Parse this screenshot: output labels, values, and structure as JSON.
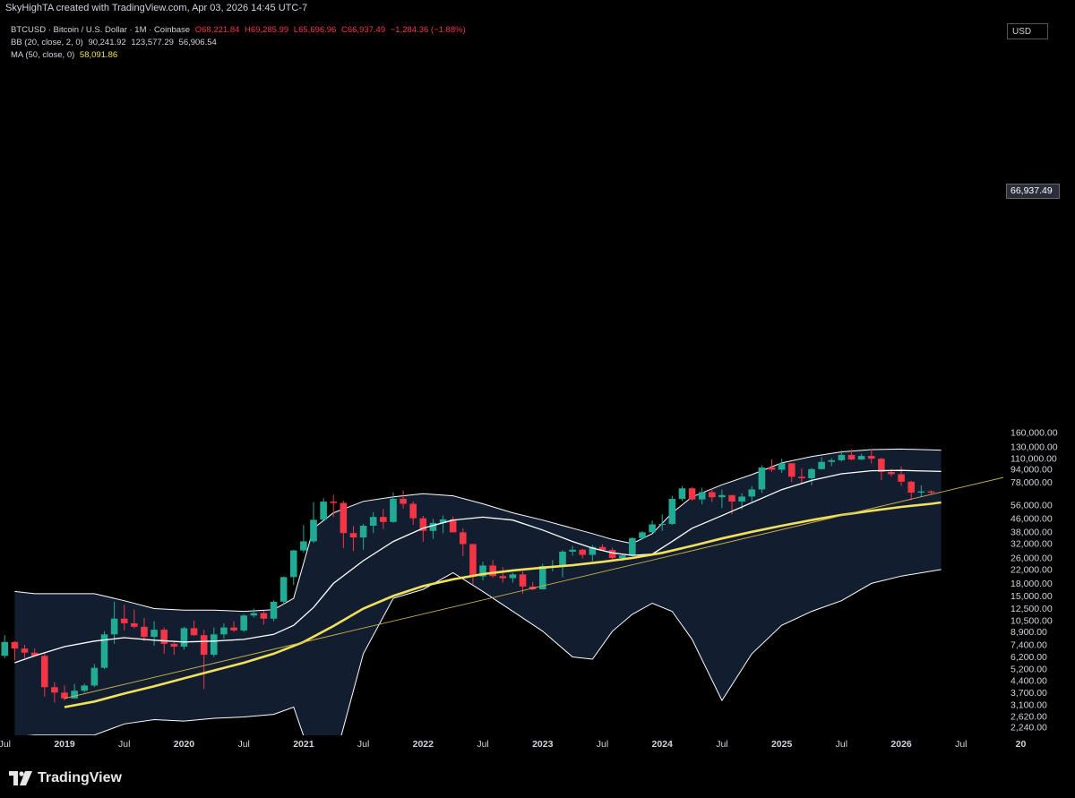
{
  "header": {
    "title": "SkyHighTA created with TradingView.com, Apr 03, 2026 14:45 UTC-7"
  },
  "legend": {
    "symbol": "BTCUSD · Bitcoin / U.S. Dollar · 1M · Coinbase",
    "open": "O68,221.84",
    "high": "H69,285.99",
    "low": "L65,696.96",
    "close": "C66,937.49",
    "change": "−1,284.36 (−1.88%)",
    "bb_label": "BB (20, close, 2, 0)",
    "bb_basis": "90,241.92",
    "bb_upper": "123,577.29",
    "bb_lower": "56,906.54",
    "ma_label": "MA (50, close, 0)",
    "ma_value": "58,091.86"
  },
  "price_axis": {
    "currency": "USD",
    "last_price": "66,937.49"
  },
  "footer": {
    "brand": "TradingView"
  },
  "colors": {
    "up": "#22ab94",
    "down": "#f23645",
    "bb_fill": "#131d30",
    "bb_line": "#ffffff",
    "ma": "#f0e05a",
    "trendline": "#c9b34a"
  },
  "chart_data": {
    "type": "candlestick",
    "scale": "log",
    "ylim": [
      2100,
      200000
    ],
    "y_ticks": [
      "2,240.00",
      "2,620.00",
      "3,100.00",
      "3,700.00",
      "4,400.00",
      "5,200.00",
      "6,200.00",
      "7,400.00",
      "8,900.00",
      "10,500.00",
      "12,500.00",
      "15,000.00",
      "18,000.00",
      "22,000.00",
      "26,000.00",
      "32,000.00",
      "38,000.00",
      "46,000.00",
      "56,000.00",
      "78,000.00",
      "94,000.00",
      "110,000.00",
      "130,000.00",
      "160,000.00"
    ],
    "y_tick_values": [
      2240,
      2620,
      3100,
      3700,
      4400,
      5200,
      6200,
      7400,
      8900,
      10500,
      12500,
      15000,
      18000,
      22000,
      26000,
      32000,
      38000,
      46000,
      56000,
      78000,
      94000,
      110000,
      130000,
      160000
    ],
    "x_ticks": [
      {
        "label": "Jul",
        "t": -6,
        "bold": false
      },
      {
        "label": "2019",
        "t": 0,
        "bold": true
      },
      {
        "label": "Jul",
        "t": 6,
        "bold": false
      },
      {
        "label": "2020",
        "t": 12,
        "bold": true
      },
      {
        "label": "Jul",
        "t": 18,
        "bold": false
      },
      {
        "label": "2021",
        "t": 24,
        "bold": true
      },
      {
        "label": "Jul",
        "t": 30,
        "bold": false
      },
      {
        "label": "2022",
        "t": 36,
        "bold": true
      },
      {
        "label": "Jul",
        "t": 42,
        "bold": false
      },
      {
        "label": "2023",
        "t": 48,
        "bold": true
      },
      {
        "label": "Jul",
        "t": 54,
        "bold": false
      },
      {
        "label": "2024",
        "t": 60,
        "bold": true
      },
      {
        "label": "Jul",
        "t": 66,
        "bold": false
      },
      {
        "label": "2025",
        "t": 72,
        "bold": true
      },
      {
        "label": "Jul",
        "t": 78,
        "bold": false
      },
      {
        "label": "2026",
        "t": 84,
        "bold": true
      },
      {
        "label": "Jul",
        "t": 90,
        "bold": false
      },
      {
        "label": "20",
        "t": 96,
        "bold": true
      }
    ],
    "time_reference": "Monthly candles; first candle = Jun 2018, last candle = Apr 2026",
    "candles": [
      {
        "date": "2018-06",
        "o": 7500,
        "h": 7800,
        "l": 5800,
        "c": 6300
      },
      {
        "date": "2018-07",
        "o": 6300,
        "h": 8500,
        "l": 6100,
        "c": 7700
      },
      {
        "date": "2018-08",
        "o": 7700,
        "h": 7800,
        "l": 5900,
        "c": 7000
      },
      {
        "date": "2018-09",
        "o": 7000,
        "h": 7400,
        "l": 6100,
        "c": 6600
      },
      {
        "date": "2018-10",
        "o": 6600,
        "h": 7000,
        "l": 6200,
        "c": 6300
      },
      {
        "date": "2018-11",
        "o": 6300,
        "h": 6600,
        "l": 3500,
        "c": 4000
      },
      {
        "date": "2018-12",
        "o": 4000,
        "h": 4300,
        "l": 3200,
        "c": 3700
      },
      {
        "date": "2019-01",
        "o": 3700,
        "h": 4100,
        "l": 3300,
        "c": 3400
      },
      {
        "date": "2019-02",
        "o": 3400,
        "h": 4200,
        "l": 3400,
        "c": 3800
      },
      {
        "date": "2019-03",
        "o": 3800,
        "h": 4200,
        "l": 3700,
        "c": 4100
      },
      {
        "date": "2019-04",
        "o": 4100,
        "h": 5600,
        "l": 4000,
        "c": 5300
      },
      {
        "date": "2019-05",
        "o": 5300,
        "h": 9000,
        "l": 5200,
        "c": 8600
      },
      {
        "date": "2019-06",
        "o": 8600,
        "h": 13800,
        "l": 7500,
        "c": 10800
      },
      {
        "date": "2019-07",
        "o": 10800,
        "h": 13200,
        "l": 9100,
        "c": 10100
      },
      {
        "date": "2019-08",
        "o": 10100,
        "h": 12300,
        "l": 9400,
        "c": 9600
      },
      {
        "date": "2019-09",
        "o": 9600,
        "h": 10900,
        "l": 7800,
        "c": 8300
      },
      {
        "date": "2019-10",
        "o": 8300,
        "h": 10400,
        "l": 7300,
        "c": 9200
      },
      {
        "date": "2019-11",
        "o": 9200,
        "h": 9500,
        "l": 6500,
        "c": 7500
      },
      {
        "date": "2019-12",
        "o": 7500,
        "h": 7700,
        "l": 6400,
        "c": 7200
      },
      {
        "date": "2020-01",
        "o": 7200,
        "h": 9600,
        "l": 6900,
        "c": 9400
      },
      {
        "date": "2020-02",
        "o": 9400,
        "h": 10500,
        "l": 8400,
        "c": 8500
      },
      {
        "date": "2020-03",
        "o": 8500,
        "h": 9200,
        "l": 3900,
        "c": 6400
      },
      {
        "date": "2020-04",
        "o": 6400,
        "h": 9500,
        "l": 6200,
        "c": 8600
      },
      {
        "date": "2020-05",
        "o": 8600,
        "h": 10100,
        "l": 8100,
        "c": 9500
      },
      {
        "date": "2020-06",
        "o": 9500,
        "h": 10400,
        "l": 8900,
        "c": 9100
      },
      {
        "date": "2020-07",
        "o": 9100,
        "h": 11500,
        "l": 8900,
        "c": 11300
      },
      {
        "date": "2020-08",
        "o": 11300,
        "h": 12500,
        "l": 11000,
        "c": 11700
      },
      {
        "date": "2020-09",
        "o": 11700,
        "h": 12100,
        "l": 9900,
        "c": 10800
      },
      {
        "date": "2020-10",
        "o": 10800,
        "h": 14100,
        "l": 10400,
        "c": 13800
      },
      {
        "date": "2020-11",
        "o": 13800,
        "h": 19900,
        "l": 13200,
        "c": 19700
      },
      {
        "date": "2020-12",
        "o": 19700,
        "h": 29300,
        "l": 17600,
        "c": 29000
      },
      {
        "date": "2021-01",
        "o": 29000,
        "h": 41900,
        "l": 28100,
        "c": 33100
      },
      {
        "date": "2021-02",
        "o": 33100,
        "h": 58400,
        "l": 32300,
        "c": 45200
      },
      {
        "date": "2021-03",
        "o": 45200,
        "h": 61800,
        "l": 45000,
        "c": 58800
      },
      {
        "date": "2021-04",
        "o": 58800,
        "h": 64900,
        "l": 47000,
        "c": 57700
      },
      {
        "date": "2021-05",
        "o": 57700,
        "h": 59500,
        "l": 30000,
        "c": 37300
      },
      {
        "date": "2021-06",
        "o": 37300,
        "h": 41300,
        "l": 28800,
        "c": 35000
      },
      {
        "date": "2021-07",
        "o": 35000,
        "h": 42600,
        "l": 29300,
        "c": 41500
      },
      {
        "date": "2021-08",
        "o": 41500,
        "h": 50500,
        "l": 37300,
        "c": 47100
      },
      {
        "date": "2021-09",
        "o": 47100,
        "h": 52900,
        "l": 39600,
        "c": 43800
      },
      {
        "date": "2021-10",
        "o": 43800,
        "h": 67000,
        "l": 43300,
        "c": 61300
      },
      {
        "date": "2021-11",
        "o": 61300,
        "h": 69000,
        "l": 53300,
        "c": 57000
      },
      {
        "date": "2021-12",
        "o": 57000,
        "h": 59100,
        "l": 42000,
        "c": 46200
      },
      {
        "date": "2022-01",
        "o": 46200,
        "h": 47900,
        "l": 32900,
        "c": 38500
      },
      {
        "date": "2022-02",
        "o": 38500,
        "h": 45800,
        "l": 34300,
        "c": 43200
      },
      {
        "date": "2022-03",
        "o": 43200,
        "h": 48200,
        "l": 37200,
        "c": 45500
      },
      {
        "date": "2022-04",
        "o": 45500,
        "h": 47400,
        "l": 37600,
        "c": 37700
      },
      {
        "date": "2022-05",
        "o": 37700,
        "h": 40000,
        "l": 26700,
        "c": 31800
      },
      {
        "date": "2022-06",
        "o": 31800,
        "h": 31900,
        "l": 17600,
        "c": 19900
      },
      {
        "date": "2022-07",
        "o": 19900,
        "h": 24600,
        "l": 18800,
        "c": 23300
      },
      {
        "date": "2022-08",
        "o": 23300,
        "h": 25200,
        "l": 19600,
        "c": 20000
      },
      {
        "date": "2022-09",
        "o": 20000,
        "h": 22800,
        "l": 18200,
        "c": 19400
      },
      {
        "date": "2022-10",
        "o": 19400,
        "h": 21000,
        "l": 18200,
        "c": 20500
      },
      {
        "date": "2022-11",
        "o": 20500,
        "h": 21400,
        "l": 15500,
        "c": 17200
      },
      {
        "date": "2022-12",
        "o": 17200,
        "h": 18400,
        "l": 16300,
        "c": 16500
      },
      {
        "date": "2023-01",
        "o": 16500,
        "h": 23900,
        "l": 16500,
        "c": 23100
      },
      {
        "date": "2023-02",
        "o": 23100,
        "h": 25200,
        "l": 21400,
        "c": 23100
      },
      {
        "date": "2023-03",
        "o": 23100,
        "h": 29200,
        "l": 19600,
        "c": 28500
      },
      {
        "date": "2023-04",
        "o": 28500,
        "h": 31000,
        "l": 26900,
        "c": 29300
      },
      {
        "date": "2023-05",
        "o": 29300,
        "h": 29800,
        "l": 25800,
        "c": 27200
      },
      {
        "date": "2023-06",
        "o": 27200,
        "h": 31400,
        "l": 24800,
        "c": 30500
      },
      {
        "date": "2023-07",
        "o": 30500,
        "h": 31800,
        "l": 28900,
        "c": 29200
      },
      {
        "date": "2023-08",
        "o": 29200,
        "h": 30200,
        "l": 25200,
        "c": 26000
      },
      {
        "date": "2023-09",
        "o": 26000,
        "h": 27500,
        "l": 24900,
        "c": 27000
      },
      {
        "date": "2023-10",
        "o": 27000,
        "h": 35000,
        "l": 26600,
        "c": 34700
      },
      {
        "date": "2023-11",
        "o": 34700,
        "h": 38400,
        "l": 34100,
        "c": 37700
      },
      {
        "date": "2023-12",
        "o": 37700,
        "h": 44700,
        "l": 37600,
        "c": 42300
      },
      {
        "date": "2024-01",
        "o": 42300,
        "h": 48900,
        "l": 38500,
        "c": 42600
      },
      {
        "date": "2024-02",
        "o": 42600,
        "h": 64000,
        "l": 41900,
        "c": 61200
      },
      {
        "date": "2024-03",
        "o": 61200,
        "h": 73800,
        "l": 59300,
        "c": 71300
      },
      {
        "date": "2024-04",
        "o": 71300,
        "h": 72800,
        "l": 59600,
        "c": 60700
      },
      {
        "date": "2024-05",
        "o": 60700,
        "h": 71900,
        "l": 56500,
        "c": 67500
      },
      {
        "date": "2024-06",
        "o": 67500,
        "h": 71900,
        "l": 58500,
        "c": 62700
      },
      {
        "date": "2024-07",
        "o": 62700,
        "h": 70000,
        "l": 53500,
        "c": 64600
      },
      {
        "date": "2024-08",
        "o": 64600,
        "h": 65000,
        "l": 49000,
        "c": 58900
      },
      {
        "date": "2024-09",
        "o": 58900,
        "h": 66500,
        "l": 52500,
        "c": 63300
      },
      {
        "date": "2024-10",
        "o": 63300,
        "h": 73600,
        "l": 58900,
        "c": 70200
      },
      {
        "date": "2024-11",
        "o": 70200,
        "h": 99600,
        "l": 66800,
        "c": 96400
      },
      {
        "date": "2024-12",
        "o": 96400,
        "h": 108300,
        "l": 90500,
        "c": 93400
      },
      {
        "date": "2025-01",
        "o": 93400,
        "h": 109300,
        "l": 89200,
        "c": 102400
      },
      {
        "date": "2025-02",
        "o": 102400,
        "h": 102500,
        "l": 78200,
        "c": 84300
      },
      {
        "date": "2025-03",
        "o": 84300,
        "h": 95000,
        "l": 76600,
        "c": 82500
      },
      {
        "date": "2025-04",
        "o": 82500,
        "h": 95800,
        "l": 74500,
        "c": 94200
      },
      {
        "date": "2025-05",
        "o": 94200,
        "h": 111900,
        "l": 93400,
        "c": 104600
      },
      {
        "date": "2025-06",
        "o": 104600,
        "h": 110500,
        "l": 98200,
        "c": 107100
      },
      {
        "date": "2025-07",
        "o": 107100,
        "h": 123200,
        "l": 105200,
        "c": 115700
      },
      {
        "date": "2025-08",
        "o": 115700,
        "h": 124400,
        "l": 107300,
        "c": 108200
      },
      {
        "date": "2025-09",
        "o": 108200,
        "h": 117900,
        "l": 107200,
        "c": 114000
      },
      {
        "date": "2025-10",
        "o": 114000,
        "h": 126000,
        "l": 102000,
        "c": 109500
      },
      {
        "date": "2025-11",
        "o": 109500,
        "h": 111000,
        "l": 80500,
        "c": 90400
      },
      {
        "date": "2025-12",
        "o": 90400,
        "h": 94500,
        "l": 84500,
        "c": 87500
      },
      {
        "date": "2026-01",
        "o": 87500,
        "h": 97800,
        "l": 74000,
        "c": 78500
      },
      {
        "date": "2026-02",
        "o": 78500,
        "h": 79500,
        "l": 60000,
        "c": 67000
      },
      {
        "date": "2026-03",
        "o": 67000,
        "h": 74500,
        "l": 63000,
        "c": 68200
      },
      {
        "date": "2026-04",
        "o": 68221.84,
        "h": 69285.99,
        "l": 65696.96,
        "c": 66937.49
      }
    ],
    "bollinger": {
      "t": [
        -5,
        -3,
        0,
        3,
        6,
        9,
        12,
        15,
        18,
        21,
        23,
        25,
        27,
        30,
        33,
        36,
        39,
        42,
        45,
        48,
        51,
        53,
        55,
        57,
        59,
        61,
        63,
        66,
        69,
        72,
        75,
        78,
        81,
        84,
        88
      ],
      "upper": [
        16000,
        15500,
        15500,
        15500,
        14000,
        12500,
        12200,
        12200,
        12000,
        12300,
        14500,
        40000,
        50000,
        59000,
        63000,
        66000,
        64000,
        57000,
        50000,
        45000,
        40000,
        37000,
        34000,
        32000,
        37000,
        50000,
        63000,
        75000,
        87000,
        103000,
        113000,
        121000,
        125000,
        126000,
        124000
      ],
      "basis": [
        5700,
        6300,
        7200,
        7800,
        8200,
        7900,
        7700,
        7800,
        8000,
        8600,
        9800,
        12700,
        18000,
        25000,
        33000,
        40000,
        45000,
        47000,
        45000,
        39000,
        33000,
        30000,
        28000,
        27000,
        27500,
        33000,
        40000,
        48000,
        58000,
        70000,
        80000,
        88000,
        92000,
        92500,
        91000
      ],
      "lower": [
        1950,
        2000,
        2000,
        2000,
        2350,
        2500,
        2450,
        2550,
        2600,
        2700,
        3000,
        1300,
        1300,
        6500,
        14500,
        16500,
        21000,
        16000,
        12000,
        9000,
        6200,
        6000,
        9000,
        11500,
        13500,
        12000,
        8000,
        3300,
        6500,
        9800,
        12000,
        14000,
        18000,
        20000,
        22000,
        40000,
        52000,
        56900
      ]
    },
    "ma50": {
      "t": [
        0,
        3,
        6,
        9,
        12,
        15,
        18,
        21,
        24,
        27,
        30,
        33,
        36,
        39,
        42,
        45,
        48,
        51,
        54,
        57,
        60,
        63,
        66,
        69,
        72,
        75,
        78,
        81,
        84,
        87,
        88
      ],
      "values": [
        3000,
        3250,
        3650,
        4050,
        4550,
        5100,
        5700,
        6500,
        7700,
        9700,
        12500,
        15000,
        17300,
        19100,
        20600,
        21700,
        22600,
        23400,
        24600,
        26000,
        28000,
        31000,
        34500,
        38000,
        41500,
        45000,
        48500,
        51500,
        54500,
        57000,
        58100
      ]
    },
    "trendline": {
      "start": {
        "date": "2019-01",
        "value": 3400
      },
      "end": {
        "date": "2026-10",
        "value": 80000
      }
    }
  }
}
